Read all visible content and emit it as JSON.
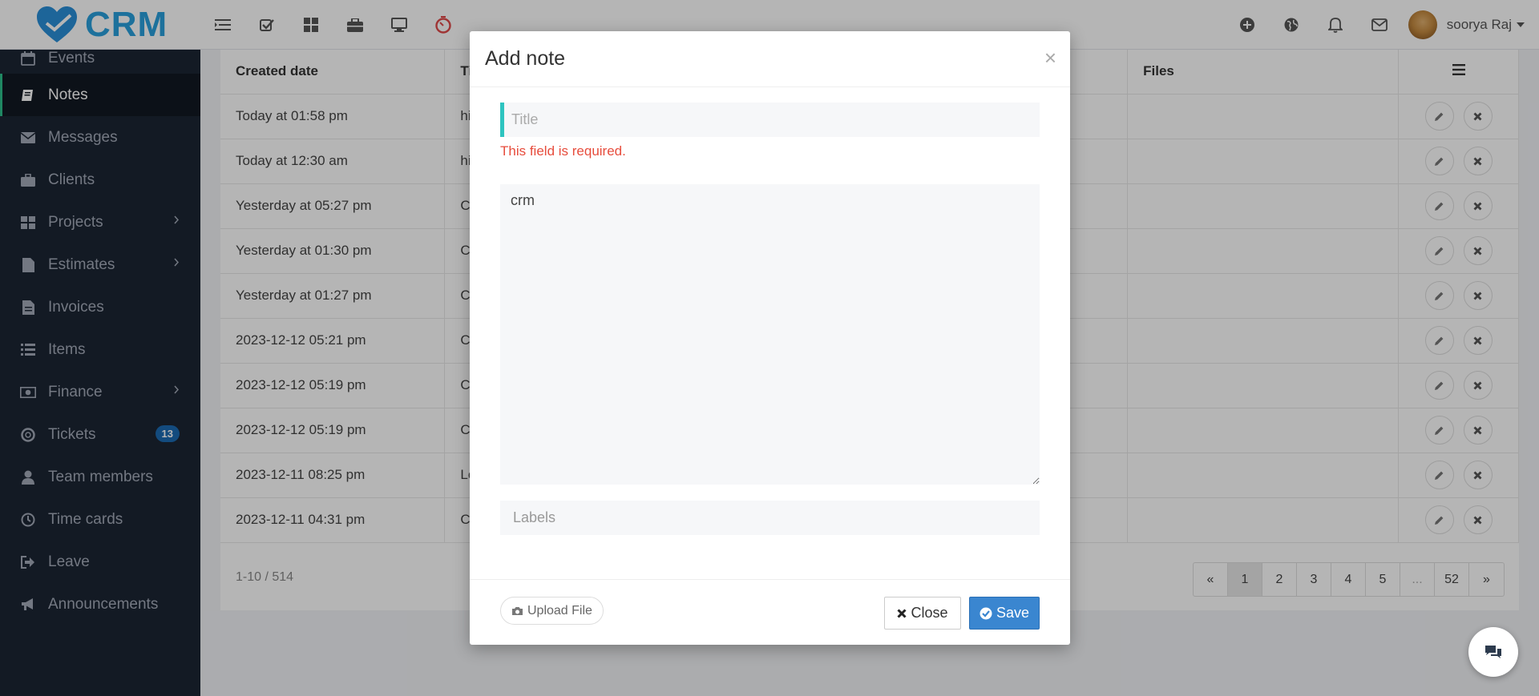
{
  "brand": {
    "name": "CRM"
  },
  "topbar": {
    "left_icons": [
      "menu-toggle-icon",
      "todo-check-icon",
      "dashboard-grid-icon",
      "briefcase-icon",
      "monitor-icon",
      "timer-clock-icon"
    ],
    "right_icons": [
      "plus-circle-icon",
      "globe-icon",
      "bell-icon",
      "envelope-icon"
    ],
    "user_name": "soorya Raj"
  },
  "sidebar": {
    "items": [
      {
        "label": "Events",
        "icon": "calendar-icon"
      },
      {
        "label": "Notes",
        "icon": "book-icon",
        "active": true
      },
      {
        "label": "Messages",
        "icon": "envelope-icon"
      },
      {
        "label": "Clients",
        "icon": "briefcase-icon"
      },
      {
        "label": "Projects",
        "icon": "grid-icon",
        "submenu": true
      },
      {
        "label": "Estimates",
        "icon": "file-icon",
        "submenu": true
      },
      {
        "label": "Invoices",
        "icon": "file-text-icon"
      },
      {
        "label": "Items",
        "icon": "list-icon"
      },
      {
        "label": "Finance",
        "icon": "money-icon",
        "submenu": true
      },
      {
        "label": "Tickets",
        "icon": "life-ring-icon",
        "badge": "13"
      },
      {
        "label": "Team members",
        "icon": "user-icon"
      },
      {
        "label": "Time cards",
        "icon": "clock-icon"
      },
      {
        "label": "Leave",
        "icon": "sign-out-icon"
      },
      {
        "label": "Announcements",
        "icon": "bullhorn-icon"
      }
    ]
  },
  "table": {
    "headers": {
      "created_date": "Created date",
      "title": "Ti",
      "files": "Files"
    },
    "rows": [
      {
        "created": "Today at 01:58 pm",
        "title": "hi"
      },
      {
        "created": "Today at 12:30 am",
        "title": "hi"
      },
      {
        "created": "Yesterday at 05:27 pm",
        "title": "CF"
      },
      {
        "created": "Yesterday at 01:30 pm",
        "title": "CF"
      },
      {
        "created": "Yesterday at 01:27 pm",
        "title": "CF"
      },
      {
        "created": "2023-12-12 05:21 pm",
        "title": "CF"
      },
      {
        "created": "2023-12-12 05:19 pm",
        "title": "CF"
      },
      {
        "created": "2023-12-12 05:19 pm",
        "title": "CF"
      },
      {
        "created": "2023-12-11 08:25 pm",
        "title": "Le"
      },
      {
        "created": "2023-12-11 04:31 pm",
        "title": "CF"
      }
    ],
    "count_text": "1-10 / 514",
    "pagination": [
      "«",
      "1",
      "2",
      "3",
      "4",
      "5",
      "...",
      "52",
      "»"
    ],
    "current_page": "1"
  },
  "modal": {
    "title": "Add note",
    "title_placeholder": "Title",
    "title_value": "",
    "error": "This field is required.",
    "description_value": "crm",
    "labels_placeholder": "Labels",
    "upload_label": "Upload File",
    "close_label": "Close",
    "save_label": "Save"
  },
  "colors": {
    "accent_teal": "#2ec4c0",
    "save_blue": "#3a86d0",
    "error_red": "#e74c3c",
    "sidebar_bg": "#1c2533",
    "brand_blue": "#29a0dc"
  }
}
